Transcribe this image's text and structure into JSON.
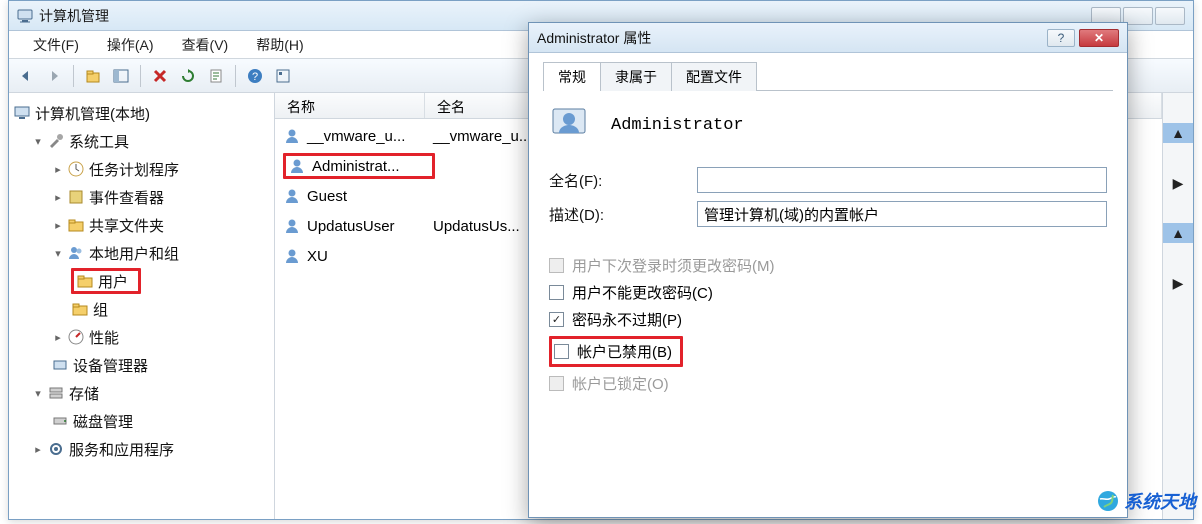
{
  "main_window": {
    "title": "计算机管理",
    "menus": {
      "file": "文件(F)",
      "action": "操作(A)",
      "view": "查看(V)",
      "help": "帮助(H)"
    }
  },
  "tree": {
    "root": "计算机管理(本地)",
    "system_tools": "系统工具",
    "task_scheduler": "任务计划程序",
    "event_viewer": "事件查看器",
    "shared_folders": "共享文件夹",
    "local_users": "本地用户和组",
    "users": "用户",
    "groups": "组",
    "performance": "性能",
    "device_manager": "设备管理器",
    "storage": "存储",
    "disk_mgmt": "磁盘管理",
    "services": "服务和应用程序"
  },
  "list": {
    "col_name": "名称",
    "col_fullname": "全名",
    "rows": [
      {
        "name": "__vmware_u...",
        "full": "__vmware_u..."
      },
      {
        "name": "Administrat...",
        "full": ""
      },
      {
        "name": "Guest",
        "full": ""
      },
      {
        "name": "UpdatusUser",
        "full": "UpdatusUs..."
      },
      {
        "name": "XU",
        "full": ""
      }
    ]
  },
  "dialog": {
    "title": "Administrator 属性",
    "tabs": {
      "general": "常规",
      "memberof": "隶属于",
      "profile": "配置文件"
    },
    "username": "Administrator",
    "fullname_label": "全名(F):",
    "fullname_value": "",
    "desc_label": "描述(D):",
    "desc_value": "管理计算机(域)的内置帐户",
    "chk_mustchange": "用户下次登录时须更改密码(M)",
    "chk_cannotchange": "用户不能更改密码(C)",
    "chk_neverexpire": "密码永不过期(P)",
    "chk_disabled": "帐户已禁用(B)",
    "chk_locked": "帐户已锁定(O)"
  },
  "watermark": "系统天地"
}
